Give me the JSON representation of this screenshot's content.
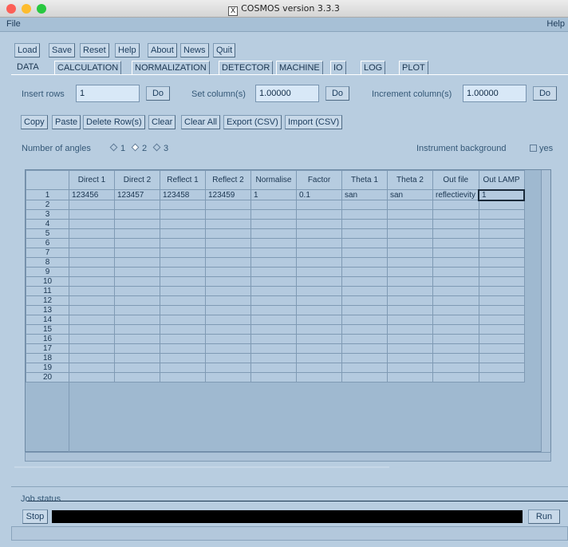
{
  "window": {
    "title": "COSMOS version 3.3.3",
    "x_icon": "x11-icon"
  },
  "menubar": {
    "file": "File",
    "help": "Help"
  },
  "toolbar": {
    "load": "Load",
    "save": "Save",
    "reset": "Reset",
    "help": "Help",
    "about": "About",
    "news": "News",
    "quit": "Quit"
  },
  "tabs": [
    "DATA",
    "CALCULATION",
    "NORMALIZATION",
    "DETECTOR",
    "MACHINE",
    "IO",
    "LOG",
    "PLOT"
  ],
  "controls": {
    "insert_rows_label": "Insert rows",
    "insert_rows_value": "1",
    "do1": "Do",
    "set_column_label": "Set column(s)",
    "set_column_value": "1.00000",
    "do2": "Do",
    "increment_label": "Increment column(s)",
    "increment_value": "1.00000",
    "do3": "Do"
  },
  "actions": {
    "copy": "Copy",
    "paste": "Paste",
    "delete_rows": "Delete Row(s)",
    "clear": "Clear",
    "clear_all": "Clear All",
    "export": "Export (CSV)",
    "import": "Import (CSV)"
  },
  "angles": {
    "label": "Number of angles",
    "options": [
      "1",
      "2",
      "3"
    ],
    "selected": "2"
  },
  "instrument": {
    "label": "Instrument background",
    "checkbox": "yes"
  },
  "table": {
    "headers": [
      "Direct 1",
      "Direct 2",
      "Reflect 1",
      "Reflect 2",
      "Normalise",
      "Factor",
      "Theta 1",
      "Theta 2",
      "Out file",
      "Out LAMP"
    ],
    "rows": [
      [
        "123456",
        "123457",
        "123458",
        "123459",
        "1",
        "0.1",
        "san",
        "san",
        "reflectievity",
        "1"
      ]
    ],
    "row_count": 20
  },
  "job": {
    "label": "Job status",
    "stop": "Stop",
    "run": "Run"
  }
}
